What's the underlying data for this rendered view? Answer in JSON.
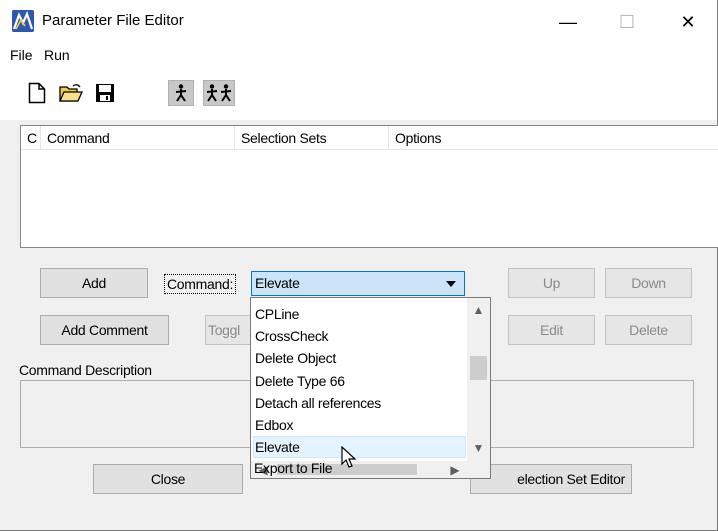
{
  "window": {
    "title": "Parameter File Editor",
    "controls": {
      "minimize": "—",
      "maximize": "☐",
      "close": "✕"
    }
  },
  "menu": {
    "items": [
      {
        "label": "File"
      },
      {
        "label": "Run"
      }
    ]
  },
  "toolbar": {
    "buttons": [
      {
        "name": "new-file-icon"
      },
      {
        "name": "open-folder-icon"
      },
      {
        "name": "save-icon"
      },
      {
        "name": "run-single-icon"
      },
      {
        "name": "run-multiple-icon"
      }
    ]
  },
  "listview": {
    "columns": [
      {
        "label": "C"
      },
      {
        "label": "Command"
      },
      {
        "label": "Selection Sets"
      },
      {
        "label": "Options"
      }
    ],
    "rows": []
  },
  "buttons": {
    "add": "Add",
    "add_comment": "Add Comment",
    "toggle": "Toggl",
    "up": "Up",
    "down": "Down",
    "edit": "Edit",
    "delete": "Delete",
    "close": "Close",
    "selection_set_editor": "election Set Editor"
  },
  "command": {
    "label": "Command:",
    "selected": "Elevate",
    "options": [
      "CPLine",
      "CrossCheck",
      "Delete Object",
      "Delete Type 66",
      "Detach all references",
      "Edbox",
      "Elevate",
      "Export to File"
    ]
  },
  "description": {
    "label": "Command Description",
    "text": ""
  },
  "scroll_icons": {
    "up": "▲",
    "down": "▼",
    "left": "◀",
    "right": "▶"
  }
}
